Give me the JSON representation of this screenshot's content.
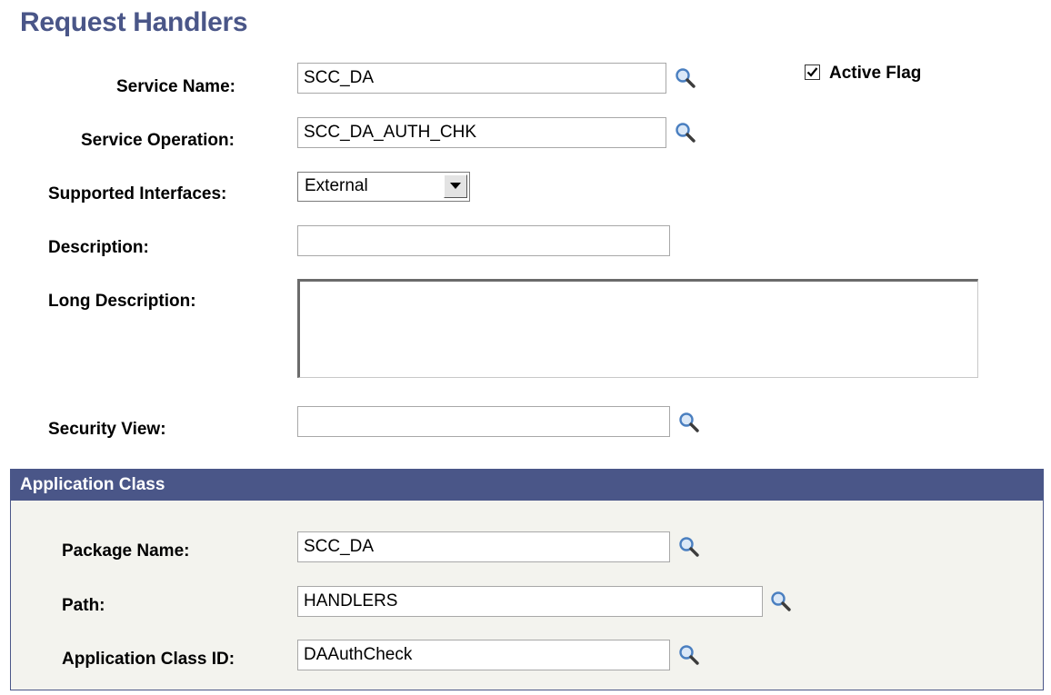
{
  "page": {
    "title": "Request Handlers"
  },
  "fields": {
    "service_name": {
      "label": "Service Name:",
      "value": "SCC_DA"
    },
    "service_operation": {
      "label": "Service Operation:",
      "value": "SCC_DA_AUTH_CHK"
    },
    "supported_interfaces": {
      "label": "Supported Interfaces:",
      "value": "External"
    },
    "description": {
      "label": "Description:",
      "value": ""
    },
    "long_description": {
      "label": "Long Description:",
      "value": ""
    },
    "security_view": {
      "label": "Security View:",
      "value": ""
    }
  },
  "active_flag": {
    "label": "Active Flag",
    "checked": true
  },
  "application_class": {
    "header": "Application Class",
    "package_name": {
      "label": "Package Name:",
      "value": "SCC_DA"
    },
    "path": {
      "label": "Path:",
      "value": "HANDLERS"
    },
    "class_id": {
      "label": "Application Class ID:",
      "value": "DAAuthCheck"
    }
  },
  "icons": {
    "lookup": "magnifier-lookup-icon",
    "dropdown": "triangle-down-icon",
    "check": "checkmark-icon"
  },
  "colors": {
    "title": "#4a5688",
    "group_header_bg": "#4a5688",
    "group_body_bg": "#f3f3ee",
    "lookup_lens": "#4a7fc0"
  }
}
